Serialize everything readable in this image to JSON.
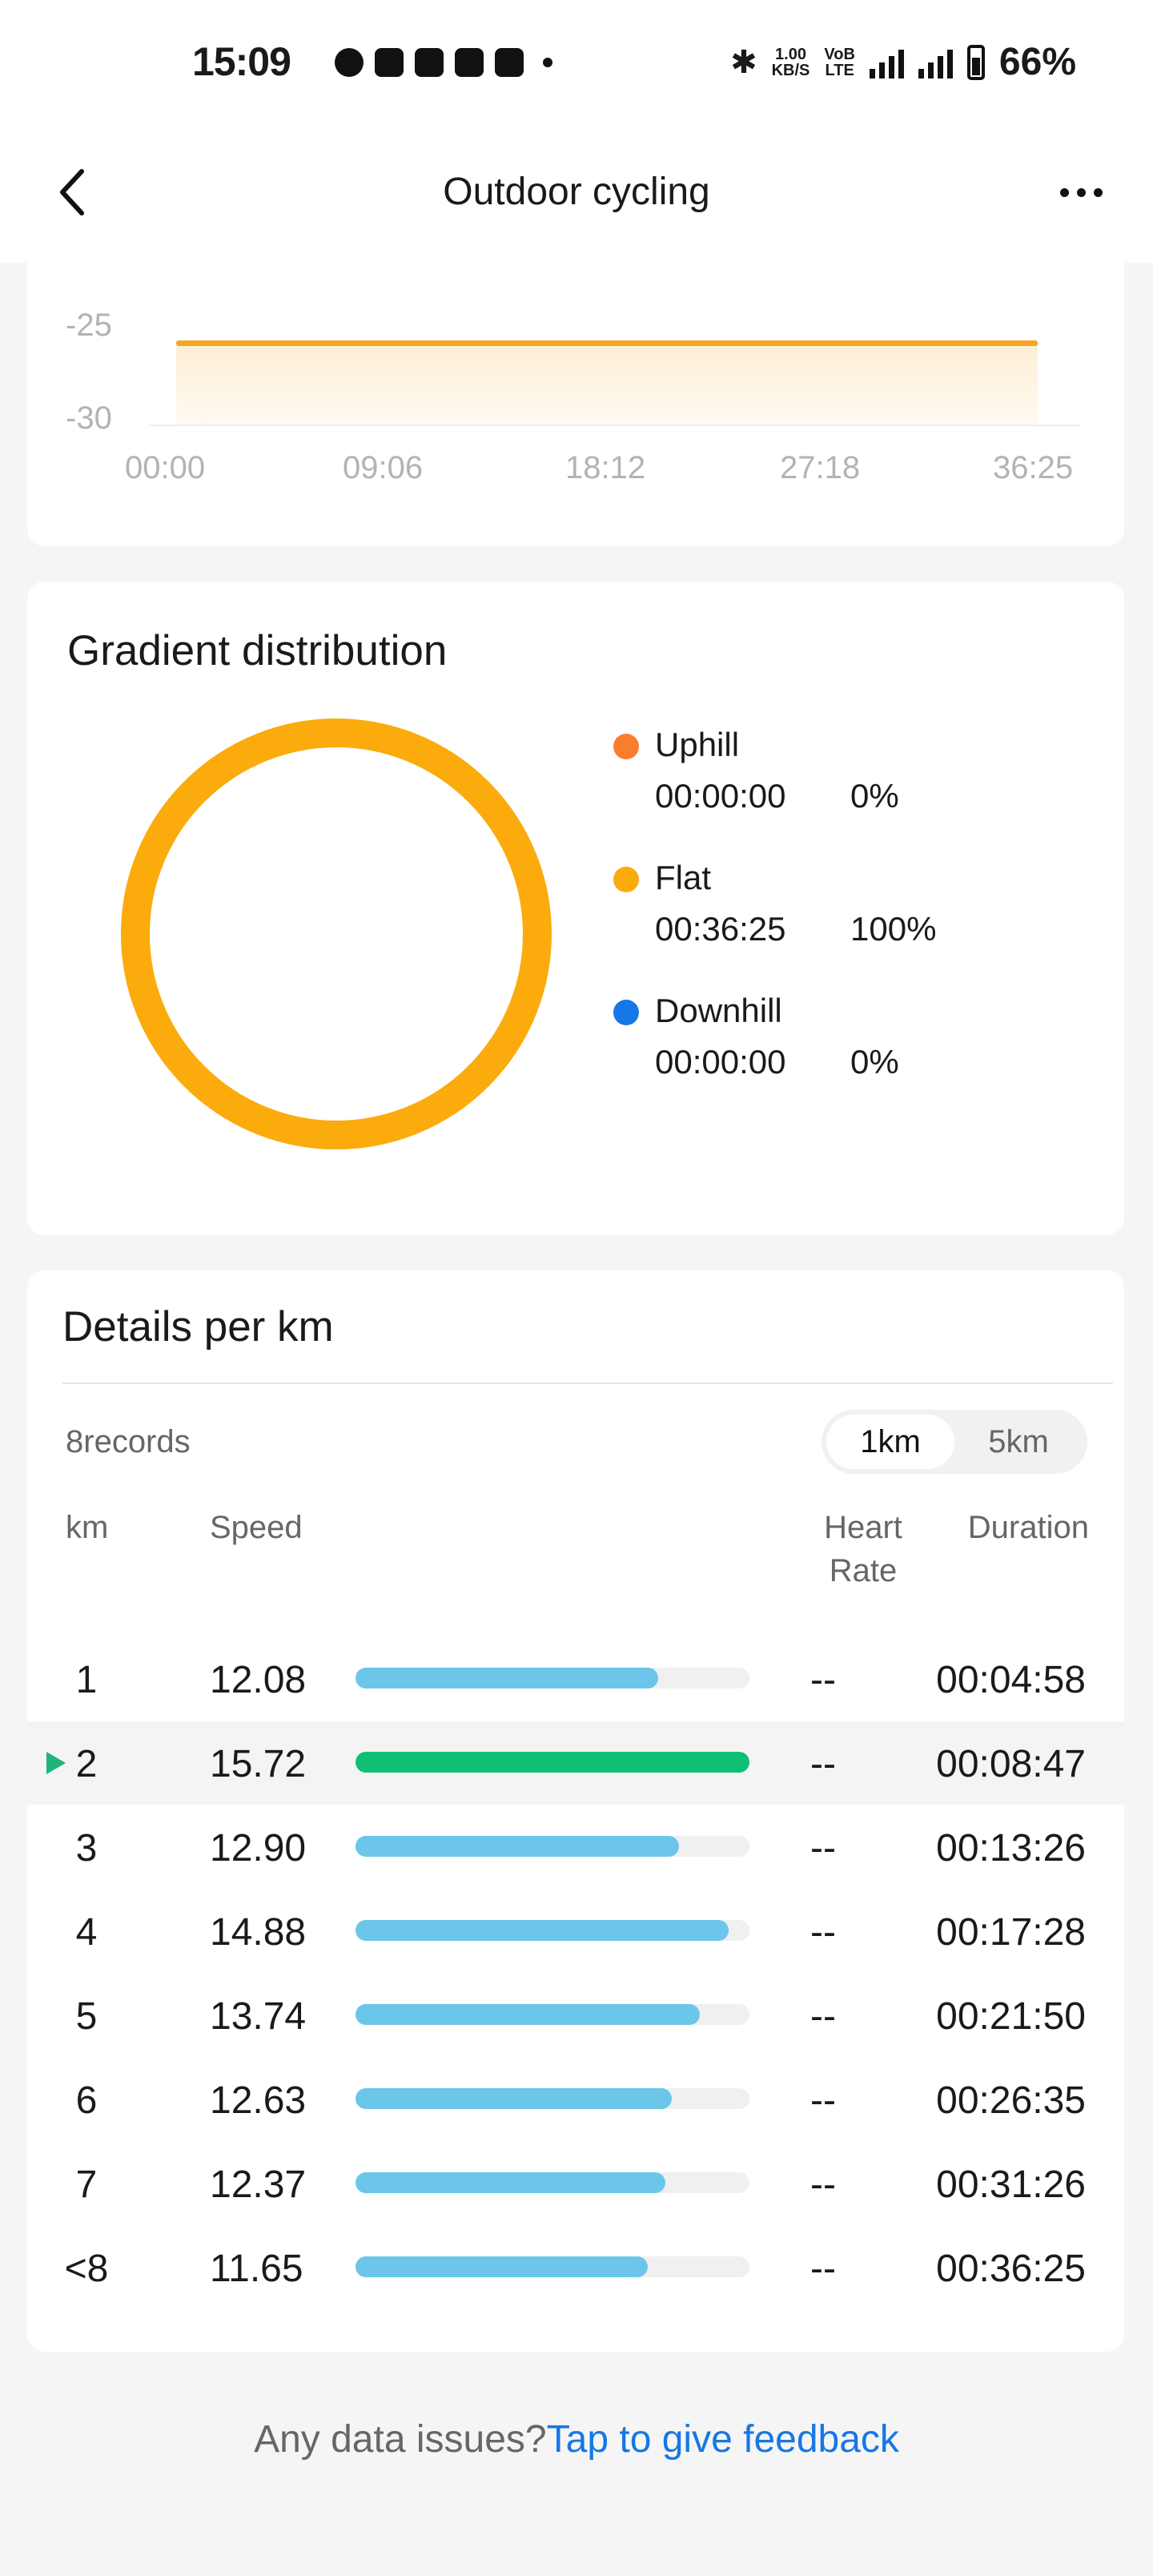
{
  "status_bar": {
    "time": "15:09",
    "net_speed": "1.00",
    "net_unit": "KB/S",
    "volte_top": "VoB",
    "volte_bottom": "LTE",
    "battery": "66%"
  },
  "header": {
    "title": "Outdoor cycling"
  },
  "elevation_chart": {
    "type": "line",
    "y_ticks": [
      "-25",
      "-30"
    ],
    "x_ticks": [
      "00:00",
      "09:06",
      "18:12",
      "27:18",
      "36:25"
    ],
    "series_value": -25.8,
    "fill_color": "#f5a623"
  },
  "gradient": {
    "title": "Gradient distribution",
    "items": [
      {
        "name": "Uphill",
        "time": "00:00:00",
        "percent": "0%",
        "color": "#fa7d2e"
      },
      {
        "name": "Flat",
        "time": "00:36:25",
        "percent": "100%",
        "color": "#fbab0c"
      },
      {
        "name": "Downhill",
        "time": "00:00:00",
        "percent": "0%",
        "color": "#1677e6"
      }
    ]
  },
  "details": {
    "title": "Details per km",
    "records": "8records",
    "toggle": {
      "active": "1km",
      "inactive": "5km"
    },
    "headers": {
      "km": "km",
      "speed": "Speed",
      "hr_line1": "Heart",
      "hr_line2": "Rate",
      "duration": "Duration"
    },
    "rows": [
      {
        "km": "1",
        "speed": "12.08",
        "speed_value": 12.08,
        "hr": "--",
        "duration": "00:04:58"
      },
      {
        "km": "2",
        "speed": "15.72",
        "speed_value": 15.72,
        "hr": "--",
        "duration": "00:08:47",
        "selected": true
      },
      {
        "km": "3",
        "speed": "12.90",
        "speed_value": 12.9,
        "hr": "--",
        "duration": "00:13:26"
      },
      {
        "km": "4",
        "speed": "14.88",
        "speed_value": 14.88,
        "hr": "--",
        "duration": "00:17:28"
      },
      {
        "km": "5",
        "speed": "13.74",
        "speed_value": 13.74,
        "hr": "--",
        "duration": "00:21:50"
      },
      {
        "km": "6",
        "speed": "12.63",
        "speed_value": 12.63,
        "hr": "--",
        "duration": "00:26:35"
      },
      {
        "km": "7",
        "speed": "12.37",
        "speed_value": 12.37,
        "hr": "--",
        "duration": "00:31:26"
      },
      {
        "km": "<8",
        "speed": "11.65",
        "speed_value": 11.65,
        "hr": "--",
        "duration": "00:36:25"
      }
    ],
    "bar_color": "#6bc6ea",
    "bar_color_max": "#0fbf75"
  },
  "feedback": {
    "prefix": "Any data issues?",
    "link": "Tap to give feedback"
  }
}
